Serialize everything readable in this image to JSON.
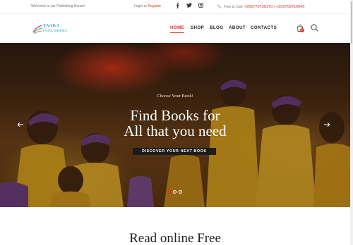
{
  "topbar": {
    "welcome": "Welcome to our Publishing House!",
    "login": "Login",
    "or": "or",
    "register": "Register",
    "social_icons": [
      "facebook-icon",
      "twitter-icon",
      "instagram-icon"
    ],
    "phone_label": "Free to Call:",
    "phone_numbers": "+256770730170 / +256709716945"
  },
  "brand": {
    "name_line1": "YAAKA",
    "name_line2": "PUBLISHERS"
  },
  "nav": {
    "items": [
      "HOME",
      "SHOP",
      "BLOG",
      "ABOUT",
      "CONTACTS"
    ],
    "active": "HOME",
    "cart_count": "0"
  },
  "hero": {
    "subtitle": "Choose Your Book!",
    "headline_line1": "Find Books for",
    "headline_line2": "All that you need",
    "cta": "DISCOVER YOUR NEXT BOOK",
    "slides": 3,
    "active_slide": 1
  },
  "section": {
    "title": "Read online Free"
  },
  "colors": {
    "accent": "#d9362c",
    "brand": "#2aa7c9",
    "button_bg": "#1c1c1c"
  }
}
